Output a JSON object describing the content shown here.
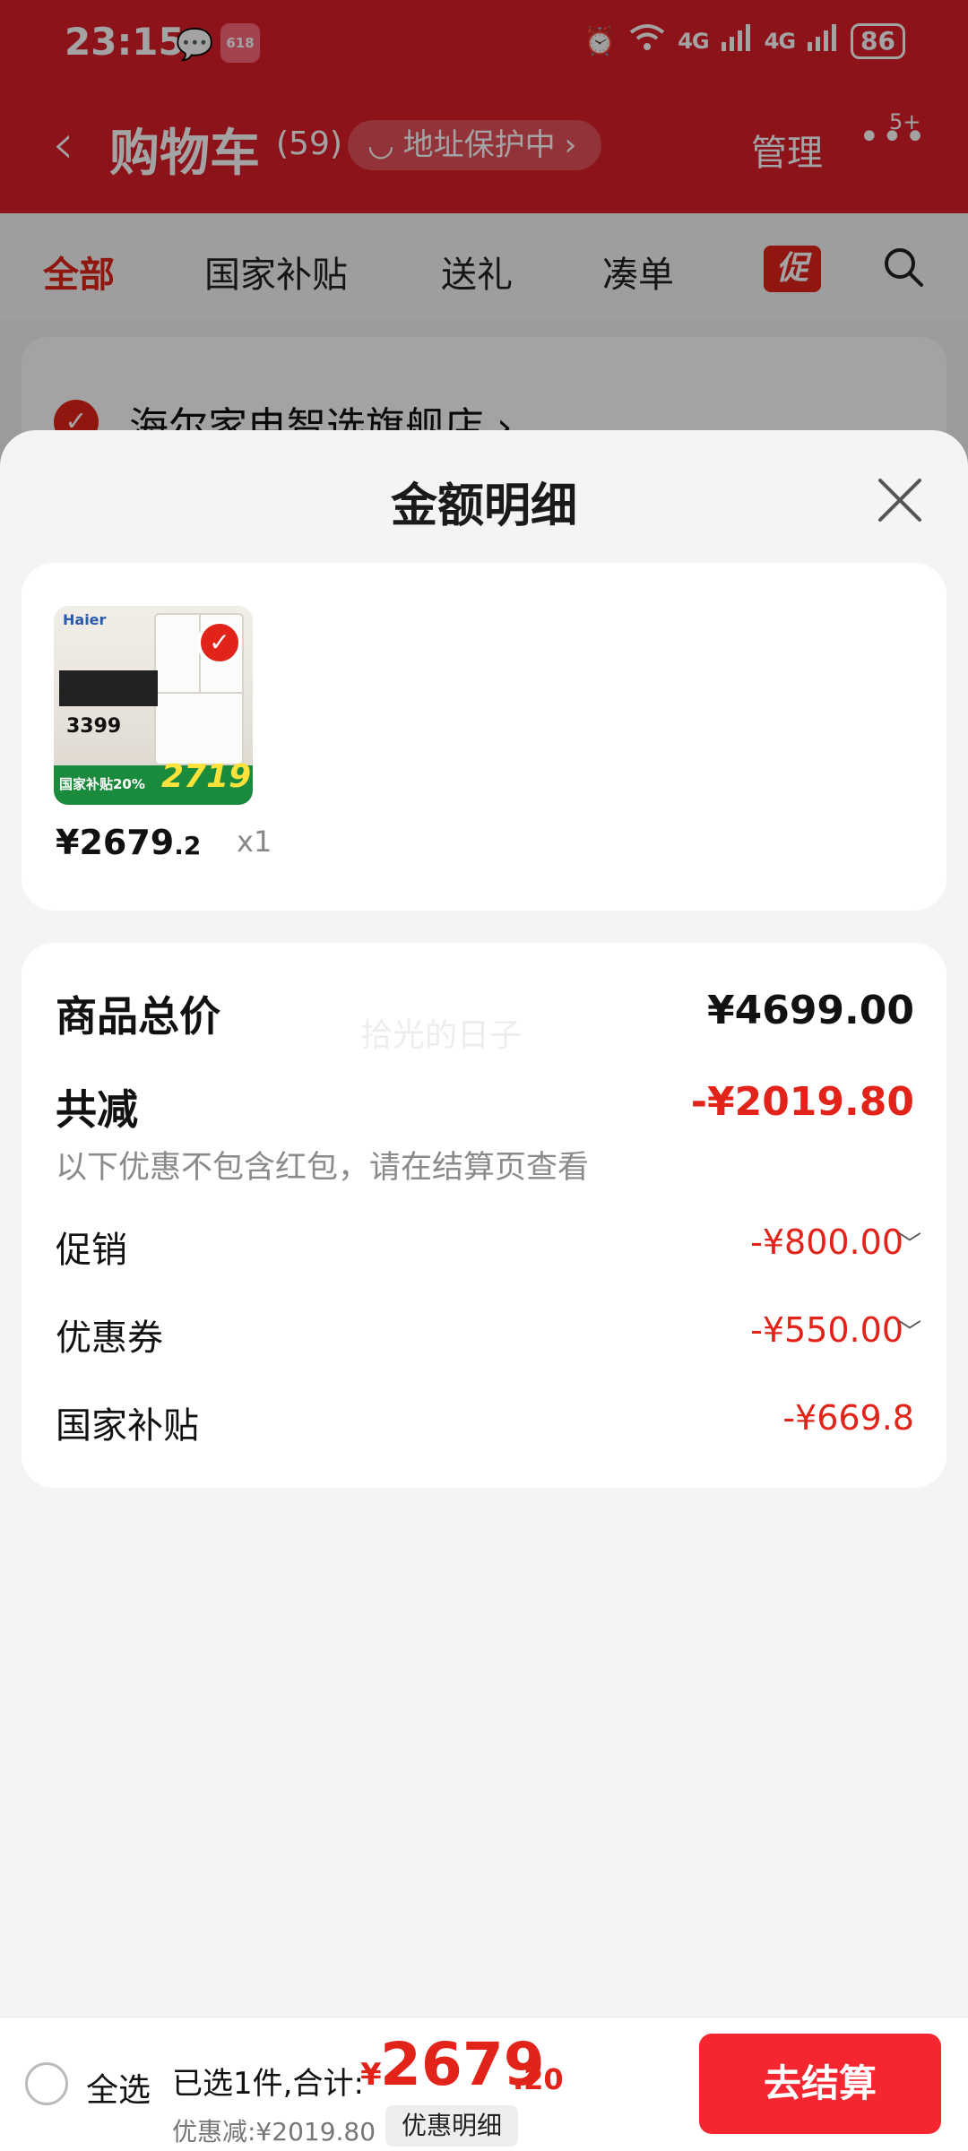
{
  "status_bar": {
    "time": "23:15",
    "sig1": "4G",
    "sig2": "4G",
    "battery": "86",
    "badge_618": "618"
  },
  "header": {
    "title": "购物车",
    "count": "(59)",
    "address_protect": "地址保护中",
    "manage": "管理",
    "more_badge": "5+"
  },
  "tabs": [
    "全部",
    "国家补贴",
    "送礼",
    "凑单"
  ],
  "tab_promo": "促",
  "store": {
    "name": "海尔家电智选旗舰店 ›"
  },
  "sheet": {
    "title": "金额明细",
    "product": {
      "price_int": "¥2679",
      "price_dec": ".2",
      "qty": "x1",
      "thumb_brand": "Haier",
      "thumb_old_price": "3399",
      "thumb_subsidy": "国家补贴20%",
      "thumb_big_price": "2719"
    },
    "details": {
      "total_label": "商品总价",
      "total_value": "¥4699.00",
      "reduce_label": "共减",
      "reduce_value": "-¥2019.80",
      "reduce_note": "以下优惠不包含红包，请在结算页查看",
      "promo_label": "促销",
      "promo_value": "-¥800.00",
      "coupon_label": "优惠券",
      "coupon_value": "-¥550.00",
      "subsidy_label": "国家补贴",
      "subsidy_value": "-¥669.8"
    },
    "watermark": "拾光的日子"
  },
  "bottom": {
    "select_all": "全选",
    "sum_label": "已选1件,合计:",
    "sum_currency": "¥",
    "sum_int": "2679",
    "sum_dec": ".20",
    "discount": "优惠减:¥2019.80",
    "detail_chip": "优惠明细",
    "checkout": "去结算"
  },
  "colors": {
    "brand_red": "#e2231a",
    "checkout_red": "#f5262f",
    "header_red": "#dc1f2a"
  }
}
